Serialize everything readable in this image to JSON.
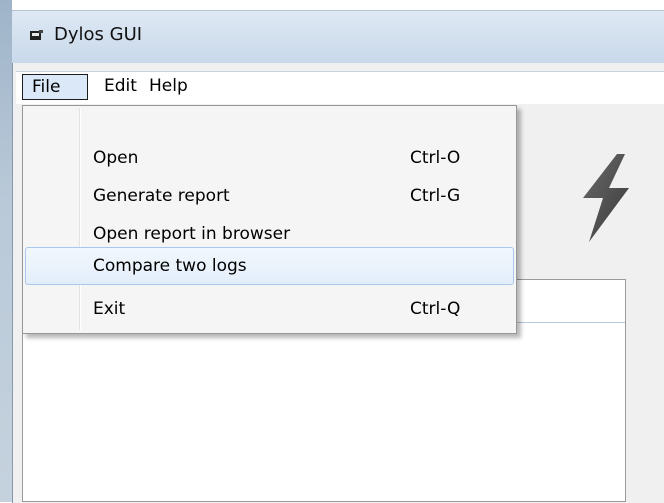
{
  "window": {
    "title": "Dylos GUI"
  },
  "menubar": {
    "file": "File",
    "edit": "Edit",
    "help": "Help"
  },
  "file_menu": {
    "items": [
      {
        "label": "Open",
        "shortcut": "Ctrl-O"
      },
      {
        "label": "Generate report",
        "shortcut": "Ctrl-G"
      },
      {
        "label": "Open report in browser",
        "shortcut": ""
      },
      {
        "label": "Compare two logs",
        "shortcut": "",
        "highlighted": true
      },
      {
        "label": "Exit",
        "shortcut": "Ctrl-Q"
      }
    ]
  },
  "icons": {
    "app": "app-icon",
    "toolbar": "lightning-icon"
  },
  "colors": {
    "menu_highlight": "#e3eefb",
    "menu_highlight_border": "#a8c8ec",
    "titlebar": "#d4e1ef"
  }
}
